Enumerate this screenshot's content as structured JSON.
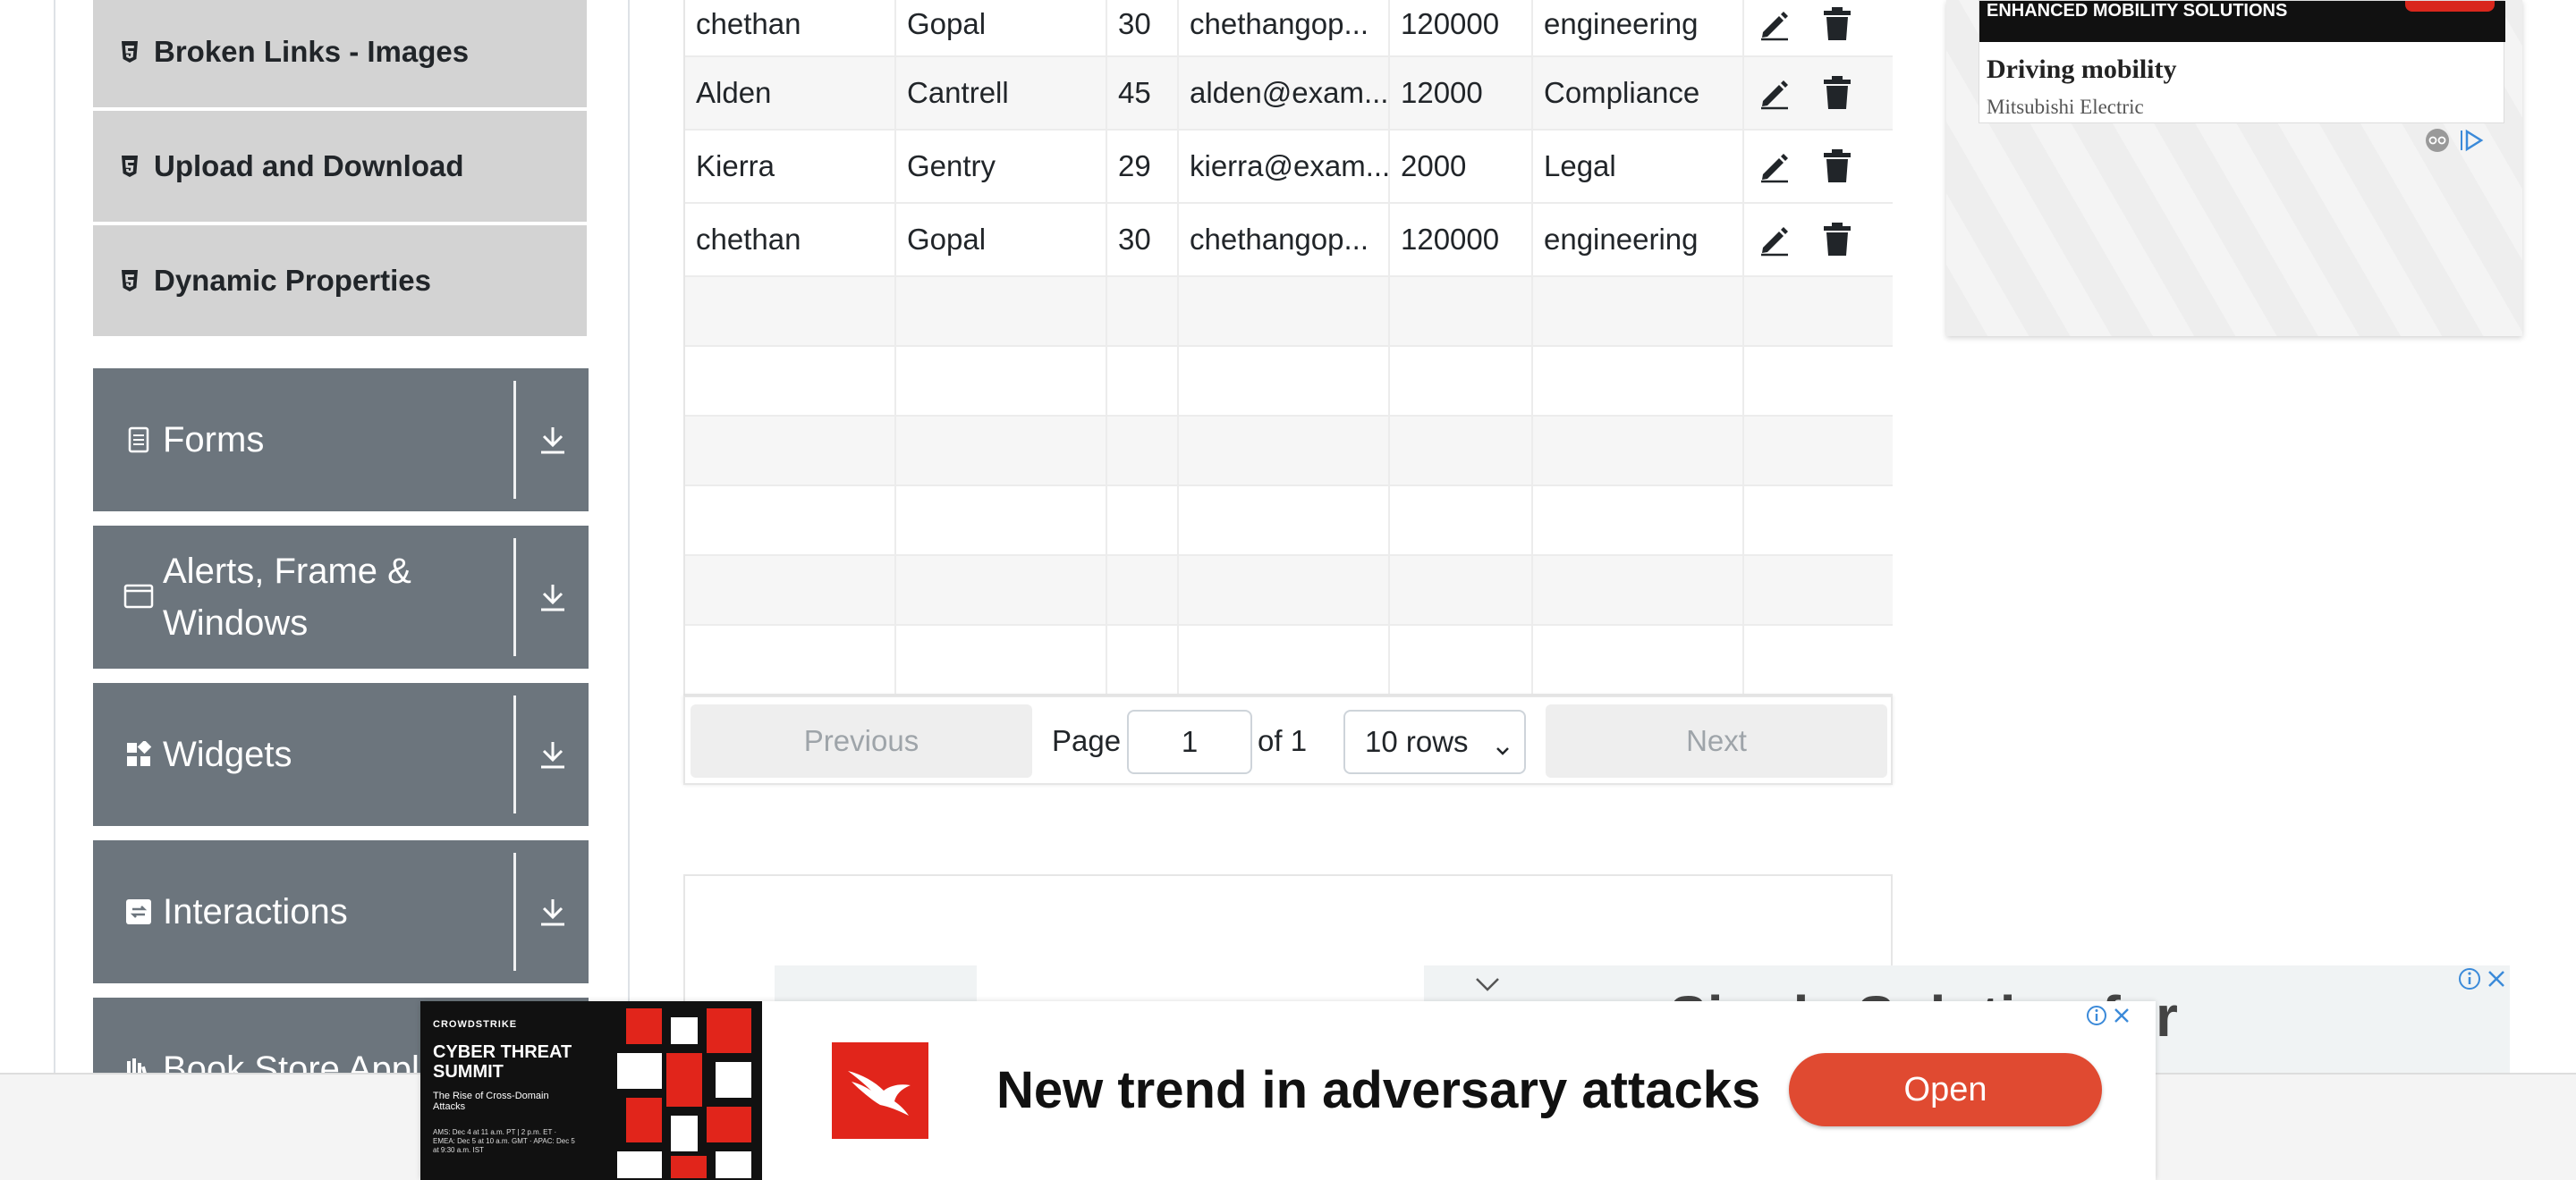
{
  "sidebar": {
    "sub_items": [
      {
        "label": "Broken Links - Images"
      },
      {
        "label": "Upload and Download"
      },
      {
        "label": "Dynamic Properties"
      }
    ],
    "groups": [
      {
        "label": "Forms"
      },
      {
        "label": "Alerts, Frame & Windows"
      },
      {
        "label": "Widgets"
      },
      {
        "label": "Interactions"
      },
      {
        "label": "Book Store Applic"
      }
    ]
  },
  "table": {
    "rows": [
      [
        "chethan",
        "Gopal",
        "30",
        "chethangop...",
        "120000",
        "engineering"
      ],
      [
        "Alden",
        "Cantrell",
        "45",
        "alden@exam...",
        "12000",
        "Compliance"
      ],
      [
        "Kierra",
        "Gentry",
        "29",
        "kierra@exam...",
        "2000",
        "Legal"
      ],
      [
        "chethan",
        "Gopal",
        "30",
        "chethangop...",
        "120000",
        "engineering"
      ]
    ],
    "empty_rows": 6
  },
  "pagination": {
    "previous_label": "Previous",
    "page_label": "Page",
    "page_value": "1",
    "of_label": "of 1",
    "rows_select": "10 rows",
    "next_label": "Next"
  },
  "right_ad": {
    "banner": "ENHANCED MOBILITY SOLUTIONS",
    "headline": "Driving mobility",
    "brand": "Mitsubishi Electric"
  },
  "bottom_ad_back": {
    "text": "Single Solution for Businesses"
  },
  "bottom_ad": {
    "image_brand": "CROWDSTRIKE",
    "image_title": "CYBER THREAT SUMMIT",
    "image_sub": "The Rise of Cross-Domain Attacks",
    "image_dates": "AMS: Dec 4 at 11 a.m. PT | 2 p.m. ET · EMEA: Dec 5 at 10 a.m. GMT · APAC: Dec 5 at 9:30 a.m. IST",
    "headline": "New trend in adversary attacks",
    "cta": "Open"
  },
  "colors": {
    "group_bg": "#6c757d",
    "sub_item_bg": "#d3d3d3",
    "cta": "#e04a31",
    "logo_red": "#e1251b"
  }
}
